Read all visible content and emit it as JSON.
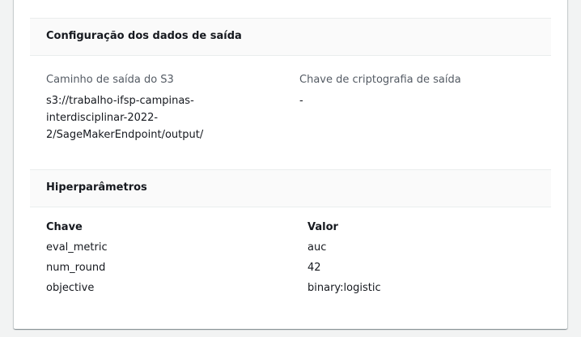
{
  "output_config": {
    "title": "Configuração dos dados de saída",
    "s3_path_label": "Caminho de saída do S3",
    "s3_path_lines": [
      "s3://trabalho-ifsp-campinas-",
      "interdisciplinar-2022-",
      "2/SageMakerEndpoint/output/"
    ],
    "encryption_key_label": "Chave de criptografia de saída",
    "encryption_key_value": "-"
  },
  "hyperparameters": {
    "title": "Hiperparâmetros",
    "columns": [
      "Chave",
      "Valor"
    ],
    "rows": [
      {
        "key": "eval_metric",
        "value": "auc"
      },
      {
        "key": "num_round",
        "value": "42"
      },
      {
        "key": "objective",
        "value": "binary:logistic"
      }
    ]
  }
}
